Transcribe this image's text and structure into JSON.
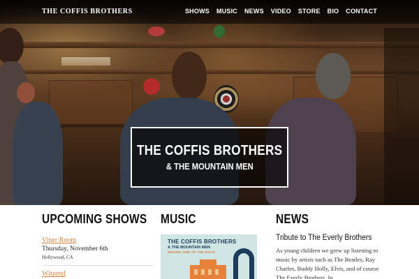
{
  "header": {
    "brand": "THE COFFIS BROTHERS",
    "nav": [
      "SHOWS",
      "MUSIC",
      "NEWS",
      "VIDEO",
      "STORE",
      "BIO",
      "CONTACT"
    ]
  },
  "hero": {
    "title": "THE COFFIS BROTHERS",
    "subtitle": "& THE MOUNTAIN MEN"
  },
  "shows": {
    "heading": "UPCOMING SHOWS",
    "items": [
      {
        "venue": "Viper Room",
        "date": "Thursday, November 6th",
        "location": "Hollywood, CA"
      },
      {
        "venue": "Witzend"
      }
    ]
  },
  "music": {
    "heading": "MUSIC",
    "album": {
      "title_line1": "THE COFFIS BROTHERS",
      "title_line2": "& THE MOUNTAIN MEN",
      "subtitle": "WRONG SIDE OF THE ROAD"
    }
  },
  "news": {
    "heading": "NEWS",
    "article_title": "Tribute to The Everly Brothers",
    "excerpt": "As young children we grew up listening to music by artists such as The Beatles, Ray Charles, Buddy Holly, Elvis, and of course The Everly Brothers. In…"
  },
  "colors": {
    "link_accent": "#d9823b",
    "album_bg": "#cfe6e4",
    "album_navy": "#1f3b5a",
    "album_orange": "#e6813a"
  }
}
